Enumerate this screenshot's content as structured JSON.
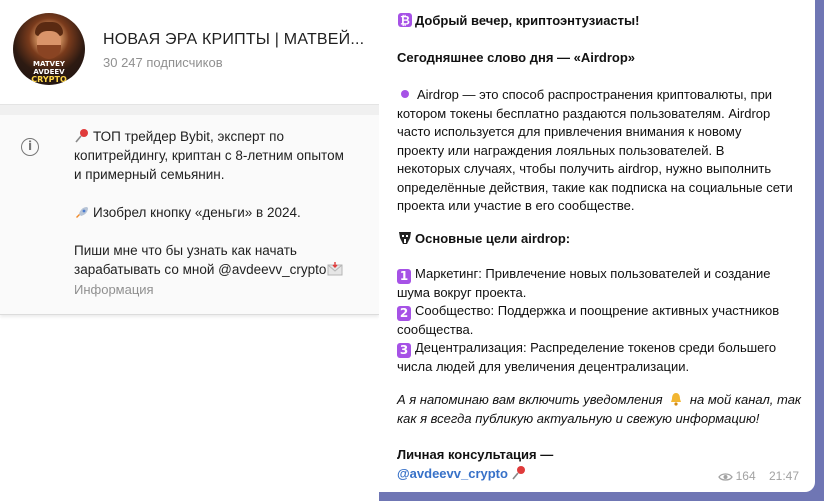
{
  "channel": {
    "title": "НОВАЯ ЭРА КРИПТЫ | МАТВЕЙ...",
    "subscribers": "30 247 подписчиков",
    "avatar_logo_lines": [
      "MATVEY",
      "AVDEEV",
      "CRYPTO"
    ]
  },
  "info": {
    "bio_line1": "ТОП трейдер Bybit, эксперт по",
    "bio_line2": "копитрейдингу, криптан с 8-летним опытом",
    "bio_line3": "и примерный семьянин.",
    "invented_line": "Изобрел кнопку «деньги» в 2024.",
    "contact_line1": "Пиши мне что бы узнать как начать",
    "contact_line2": "зарабатывать со мной @avdeevv_crypto",
    "label": "Информация",
    "icons": [
      "pushpin-icon",
      "rocket-icon",
      "envelope-icon",
      "info-icon"
    ]
  },
  "message": {
    "greeting": "Добрый вечер, криптоэнтузиасты!",
    "word_of_day": "Сегодняшнее слово дня — «Airdrop»",
    "def_1": "Airdrop — это способ распространения криптовалюты, при",
    "def_2": "котором токены бесплатно раздаются пользователям. Airdrop",
    "def_3": "часто используется для привлечения внимания к новому",
    "def_4": "проекту или награждения лояльных пользователей. В",
    "def_5": "некоторых случаях, чтобы получить airdrop, нужно выполнить",
    "def_6": "определённые действия, такие как подписка на социальные сети",
    "def_7": "проекта или участие в его сообществе.",
    "goals_title": "Основные цели airdrop:",
    "goal1_num": "1",
    "goal1_a": "Маркетинг: Привлечение новых пользователей и создание",
    "goal1_b": "шума вокруг проекта.",
    "goal2_num": "2",
    "goal2_a": "Сообщество: Поддержка и поощрение активных участников",
    "goal2_b": "сообщества.",
    "goal3_num": "3",
    "goal3_a": "Децентрализация: Распределение токенов среди большего",
    "goal3_b": "числа людей для увеличения децентрализации.",
    "reminder_a": "А я напоминаю вам включить уведомления",
    "reminder_a2": "на мой канал, так",
    "reminder_b": "как я всегда публикую актуальную и свежую информацию!",
    "consult_title": "Личная консультация —",
    "consult_link": "@avdeevv_crypto",
    "views": "164",
    "time": "21:47",
    "accent_color": "#a652e6",
    "link_color": "#3771c8"
  }
}
